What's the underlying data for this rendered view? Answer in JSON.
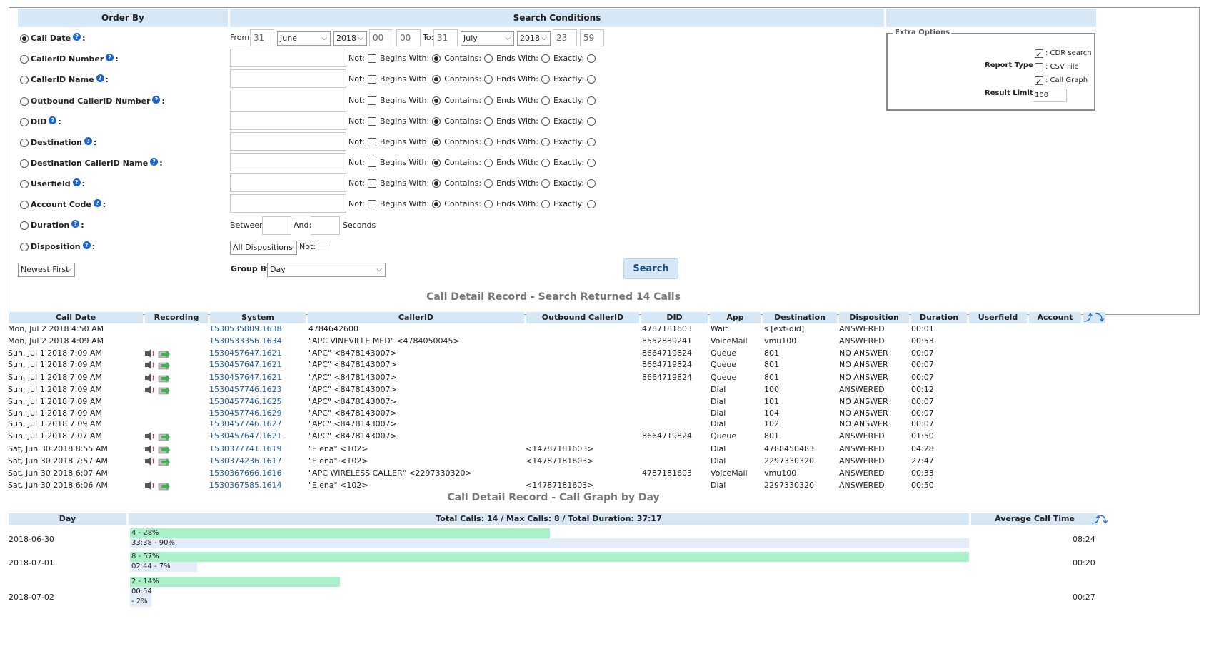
{
  "form": {
    "order_by_header": "Order By",
    "search_conditions_header": "Search Conditions",
    "fields": [
      {
        "label": "Call Date",
        "checked": true
      },
      {
        "label": "CallerID Number",
        "checked": false
      },
      {
        "label": "CallerID Name",
        "checked": false
      },
      {
        "label": "Outbound CallerID Number",
        "checked": false
      },
      {
        "label": "DID",
        "checked": false
      },
      {
        "label": "Destination",
        "checked": false
      },
      {
        "label": "Destination CallerID Name",
        "checked": false
      },
      {
        "label": "Userfield",
        "checked": false
      },
      {
        "label": "Account Code",
        "checked": false
      },
      {
        "label": "Duration",
        "checked": false
      },
      {
        "label": "Disposition",
        "checked": false
      }
    ],
    "from_label": "From:",
    "from_day": "31",
    "from_month": "June",
    "from_year": "2018",
    "from_hour": "00",
    "from_min": "00",
    "to_label": "To:",
    "to_day": "31",
    "to_month": "July",
    "to_year": "2018",
    "to_hour": "23",
    "to_min": "59",
    "not_label": "Not:",
    "begins_label": "Begins With:",
    "contains_label": "Contains:",
    "ends_label": "Ends With:",
    "exactly_label": "Exactly:",
    "between_label": "Between:",
    "and_label": "And:",
    "seconds_label": "Seconds",
    "disposition_value": "All Dispositions",
    "disposition_not_label": "Not:",
    "order_value": "Newest First",
    "group_by_label": "Group By:",
    "group_by_value": "Day",
    "search_button": "Search",
    "extra_options_legend": "Extra Options",
    "report_type_label": "Report Type :",
    "opt_cdr": ": CDR search",
    "opt_csv": ": CSV File",
    "opt_graph": ": Call Graph",
    "opt_cdr_checked": true,
    "opt_csv_checked": false,
    "opt_graph_checked": true,
    "result_limit_label": "Result Limit :",
    "result_limit_value": "100"
  },
  "results": {
    "title": "Call Detail Record - Search Returned 14 Calls",
    "columns": [
      "Call Date",
      "Recording",
      "System",
      "CallerID",
      "Outbound CallerID",
      "DID",
      "App",
      "Destination",
      "Disposition",
      "Duration",
      "Userfield",
      "Account"
    ],
    "rows": [
      {
        "date": "Mon, Jul 2 2018 4:50 AM",
        "rec": false,
        "system": "1530535809.1638",
        "callerid": "4784642600",
        "outbound": "",
        "did": "4787181603",
        "app": "Wait",
        "dest": "s [ext-did]",
        "disp": "ANSWERED",
        "dur": "00:01"
      },
      {
        "date": "Mon, Jul 2 2018 4:09 AM",
        "rec": false,
        "system": "1530533356.1634",
        "callerid": "\"APC VINEVILLE MED\" <4784050045>",
        "outbound": "",
        "did": "8552839241",
        "app": "VoiceMail",
        "dest": "vmu100",
        "disp": "ANSWERED",
        "dur": "00:53"
      },
      {
        "date": "Sun, Jul 1 2018 7:09 AM",
        "rec": true,
        "system": "1530457647.1621",
        "callerid": "\"APC\" <8478143007>",
        "outbound": "",
        "did": "8664719824",
        "app": "Queue",
        "dest": "801",
        "disp": "NO ANSWER",
        "dur": "00:07"
      },
      {
        "date": "Sun, Jul 1 2018 7:09 AM",
        "rec": true,
        "system": "1530457647.1621",
        "callerid": "\"APC\" <8478143007>",
        "outbound": "",
        "did": "8664719824",
        "app": "Queue",
        "dest": "801",
        "disp": "NO ANSWER",
        "dur": "00:07"
      },
      {
        "date": "Sun, Jul 1 2018 7:09 AM",
        "rec": true,
        "system": "1530457647.1621",
        "callerid": "\"APC\" <8478143007>",
        "outbound": "",
        "did": "8664719824",
        "app": "Queue",
        "dest": "801",
        "disp": "NO ANSWER",
        "dur": "00:07"
      },
      {
        "date": "Sun, Jul 1 2018 7:09 AM",
        "rec": true,
        "system": "1530457746.1623",
        "callerid": "\"APC\" <8478143007>",
        "outbound": "",
        "did": "",
        "app": "Dial",
        "dest": "100",
        "disp": "ANSWERED",
        "dur": "00:12"
      },
      {
        "date": "Sun, Jul 1 2018 7:09 AM",
        "rec": false,
        "system": "1530457746.1625",
        "callerid": "\"APC\" <8478143007>",
        "outbound": "",
        "did": "",
        "app": "Dial",
        "dest": "101",
        "disp": "NO ANSWER",
        "dur": "00:07"
      },
      {
        "date": "Sun, Jul 1 2018 7:09 AM",
        "rec": false,
        "system": "1530457746.1629",
        "callerid": "\"APC\" <8478143007>",
        "outbound": "",
        "did": "",
        "app": "Dial",
        "dest": "104",
        "disp": "NO ANSWER",
        "dur": "00:07"
      },
      {
        "date": "Sun, Jul 1 2018 7:09 AM",
        "rec": false,
        "system": "1530457746.1627",
        "callerid": "\"APC\" <8478143007>",
        "outbound": "",
        "did": "",
        "app": "Dial",
        "dest": "102",
        "disp": "NO ANSWER",
        "dur": "00:07"
      },
      {
        "date": "Sun, Jul 1 2018 7:07 AM",
        "rec": true,
        "system": "1530457647.1621",
        "callerid": "\"APC\" <8478143007>",
        "outbound": "",
        "did": "8664719824",
        "app": "Queue",
        "dest": "801",
        "disp": "ANSWERED",
        "dur": "01:50"
      },
      {
        "date": "Sat, Jun 30 2018 8:55 AM",
        "rec": true,
        "system": "1530377741.1619",
        "callerid": "\"Elena\" <102>",
        "outbound": "<14787181603>",
        "did": "",
        "app": "Dial",
        "dest": "4788450483",
        "disp": "ANSWERED",
        "dur": "04:28"
      },
      {
        "date": "Sat, Jun 30 2018 7:57 AM",
        "rec": true,
        "system": "1530374236.1617",
        "callerid": "\"Elena\" <102>",
        "outbound": "<14787181603>",
        "did": "",
        "app": "Dial",
        "dest": "2297330320",
        "disp": "ANSWERED",
        "dur": "27:47"
      },
      {
        "date": "Sat, Jun 30 2018 6:07 AM",
        "rec": false,
        "system": "1530367666.1616",
        "callerid": "\"APC WIRELESS CALLER\" <2297330320>",
        "outbound": "",
        "did": "4787181603",
        "app": "VoiceMail",
        "dest": "vmu100",
        "disp": "ANSWERED",
        "dur": "00:33"
      },
      {
        "date": "Sat, Jun 30 2018 6:06 AM",
        "rec": true,
        "system": "1530367585.1614",
        "callerid": "\"Elena\" <102>",
        "outbound": "<14787181603>",
        "did": "",
        "app": "Dial",
        "dest": "2297330320",
        "disp": "ANSWERED",
        "dur": "00:50"
      }
    ]
  },
  "graph": {
    "title": "Call Detail Record - Call Graph by Day",
    "day_header": "Day",
    "summary_header": "Total Calls: 14 / Max Calls: 8 / Total Duration: 37:17",
    "avg_header": "Average Call Time",
    "rows": [
      {
        "day": "2018-06-30",
        "calls_label": "4 - 28%",
        "calls_fraction": 0.5,
        "dur_label": "33:38 - 90%",
        "dur_fraction": 1.0,
        "avg": "08:24"
      },
      {
        "day": "2018-07-01",
        "calls_label": "8 - 57%",
        "calls_fraction": 1.0,
        "dur_label": "02:44 - 7%",
        "dur_fraction": 0.08,
        "avg": "00:20"
      },
      {
        "day": "2018-07-02",
        "calls_label": "2 - 14%",
        "calls_fraction": 0.25,
        "dur_label": "00:54\n- 2%",
        "dur_fraction": 0.025,
        "avg": "00:27"
      }
    ]
  },
  "icons": {
    "help": "help-icon",
    "speaker": "speaker-icon",
    "download": "download-icon",
    "sort": "sort-icon"
  }
}
